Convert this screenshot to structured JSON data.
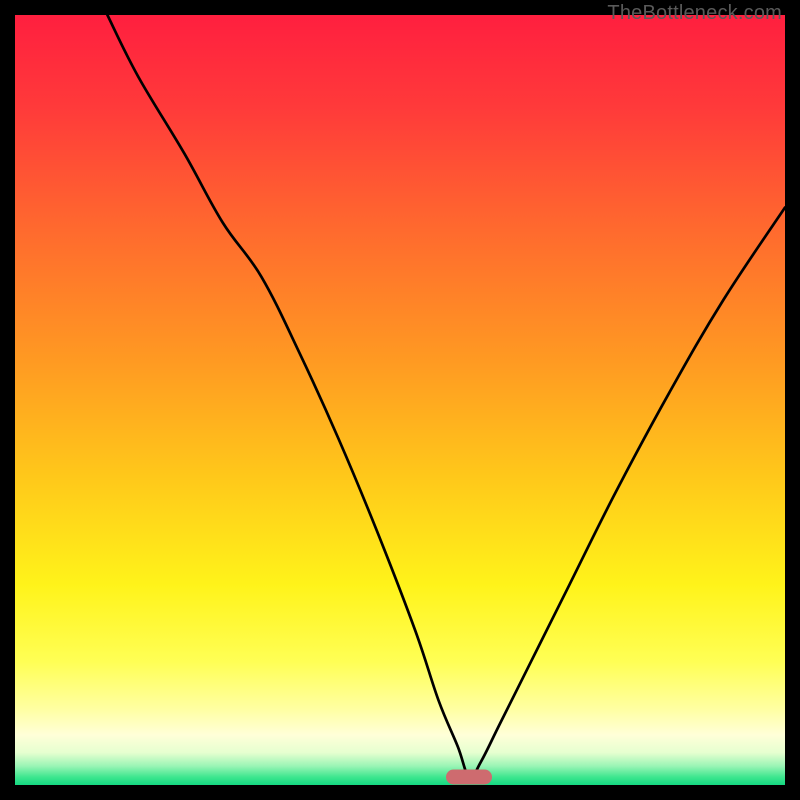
{
  "watermark": "TheBottleneck.com",
  "chart_data": {
    "type": "line",
    "title": "",
    "xlabel": "",
    "ylabel": "",
    "xlim": [
      0,
      100
    ],
    "ylim": [
      0,
      100
    ],
    "grid": false,
    "legend": false,
    "marker": {
      "x": 59,
      "y": 1,
      "color": "#ce6b6f"
    },
    "gradient_stops": [
      {
        "t": 0.0,
        "color": "#ff1f3f"
      },
      {
        "t": 0.12,
        "color": "#ff3a3a"
      },
      {
        "t": 0.28,
        "color": "#ff6a2e"
      },
      {
        "t": 0.45,
        "color": "#ff9a22"
      },
      {
        "t": 0.6,
        "color": "#ffc81a"
      },
      {
        "t": 0.74,
        "color": "#fff31a"
      },
      {
        "t": 0.84,
        "color": "#ffff55"
      },
      {
        "t": 0.9,
        "color": "#ffffa0"
      },
      {
        "t": 0.935,
        "color": "#ffffd8"
      },
      {
        "t": 0.958,
        "color": "#e6ffd0"
      },
      {
        "t": 0.975,
        "color": "#9cf5b6"
      },
      {
        "t": 0.99,
        "color": "#3ce68e"
      },
      {
        "t": 1.0,
        "color": "#15d882"
      }
    ],
    "series": [
      {
        "name": "bottleneck-curve",
        "x": [
          12,
          16,
          22,
          27,
          32,
          37,
          42,
          47,
          52,
          55,
          57.5,
          59,
          60.5,
          63,
          67,
          72,
          78,
          85,
          92,
          100
        ],
        "y": [
          100,
          92,
          82,
          73,
          66,
          56,
          45,
          33,
          20,
          11,
          5,
          1,
          3,
          8,
          16,
          26,
          38,
          51,
          63,
          75
        ]
      }
    ]
  }
}
